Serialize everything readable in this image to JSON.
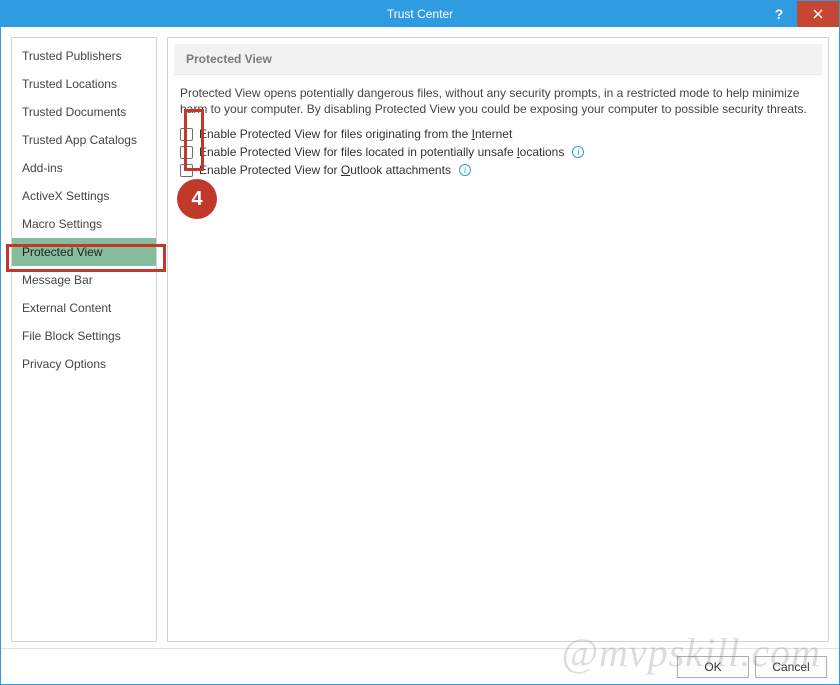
{
  "window": {
    "title": "Trust Center"
  },
  "titlebar": {
    "help": "?",
    "close": "×"
  },
  "sidebar": {
    "items": [
      {
        "label": "Trusted Publishers"
      },
      {
        "label": "Trusted Locations"
      },
      {
        "label": "Trusted Documents"
      },
      {
        "label": "Trusted App Catalogs"
      },
      {
        "label": "Add-ins"
      },
      {
        "label": "ActiveX Settings"
      },
      {
        "label": "Macro Settings"
      },
      {
        "label": "Protected View",
        "selected": true
      },
      {
        "label": "Message Bar"
      },
      {
        "label": "External Content"
      },
      {
        "label": "File Block Settings"
      },
      {
        "label": "Privacy Options"
      }
    ]
  },
  "main": {
    "section_title": "Protected View",
    "description": "Protected View opens potentially dangerous files, without any security prompts, in a restricted mode to help minimize harm to your computer. By disabling Protected View you could be exposing your computer to possible security threats.",
    "options": [
      {
        "label_pre": "Enable Protected View for files originating from the ",
        "u": "I",
        "label_post": "nternet",
        "checked": false,
        "info": false
      },
      {
        "label_pre": "Enable Protected View for files located in potentially unsafe ",
        "u": "l",
        "label_post": "ocations",
        "checked": false,
        "info": true
      },
      {
        "label_pre": "Enable Protected View for ",
        "u": "O",
        "label_post": "utlook attachments",
        "checked": false,
        "info": true
      }
    ]
  },
  "footer": {
    "ok": "OK",
    "cancel": "Cancel"
  },
  "annotation": {
    "badge": "4"
  },
  "watermark": "@mvpskill.com",
  "colors": {
    "accent": "#2f9be0",
    "selected": "#86bd9d",
    "anno": "#c0392b"
  }
}
